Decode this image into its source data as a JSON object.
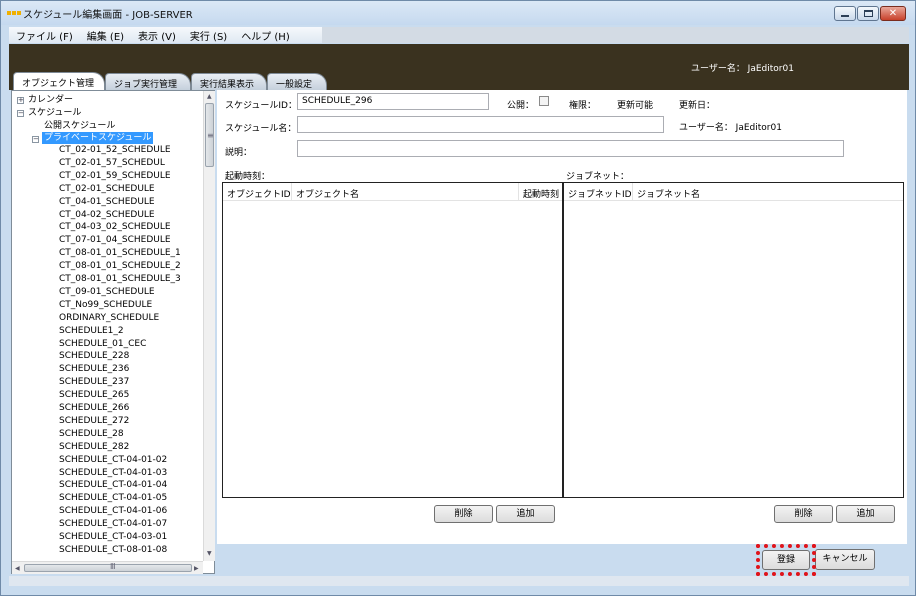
{
  "window": {
    "title": "スケジュール編集画面 - JOB-SERVER"
  },
  "menu": [
    {
      "label": "ファイル (F)"
    },
    {
      "label": "編集 (E)"
    },
    {
      "label": "表示 (V)"
    },
    {
      "label": "実行 (S)"
    },
    {
      "label": "ヘルプ (H)"
    }
  ],
  "header": {
    "user": "ユーザー名： JaEditor01"
  },
  "tabs": [
    {
      "label": "オブジェクト管理",
      "active": true
    },
    {
      "label": "ジョブ実行管理",
      "active": false
    },
    {
      "label": "実行結果表示",
      "active": false
    },
    {
      "label": "一般設定",
      "active": false
    }
  ],
  "tree": {
    "calendar": "カレンダー",
    "schedule": "スケジュール",
    "public_schedule": "公開スケジュール",
    "private_schedule": "プライベートスケジュール",
    "items": [
      "CT_02-01_52_SCHEDULE",
      "CT_02-01_57_SCHEDUL",
      "CT_02-01_59_SCHEDULE",
      "CT_02-01_SCHEDULE",
      "CT_04-01_SCHEDULE",
      "CT_04-02_SCHEDULE",
      "CT_04-03_02_SCHEDULE",
      "CT_07-01_04_SCHEDULE",
      "CT_08-01_01_SCHEDULE_1",
      "CT_08-01_01_SCHEDULE_2",
      "CT_08-01_01_SCHEDULE_3",
      "CT_09-01_SCHEDULE",
      "CT_No99_SCHEDULE",
      "ORDINARY_SCHEDULE",
      "SCHEDULE1_2",
      "SCHEDULE_01_CEC",
      "SCHEDULE_228",
      "SCHEDULE_236",
      "SCHEDULE_237",
      "SCHEDULE_265",
      "SCHEDULE_266",
      "SCHEDULE_272",
      "SCHEDULE_28",
      "SCHEDULE_282",
      "SCHEDULE_CT-04-01-02",
      "SCHEDULE_CT-04-01-03",
      "SCHEDULE_CT-04-01-04",
      "SCHEDULE_CT-04-01-05",
      "SCHEDULE_CT-04-01-06",
      "SCHEDULE_CT-04-01-07",
      "SCHEDULE_CT-04-03-01",
      "SCHEDULE_CT-08-01-08"
    ],
    "hscroll_grip": "Ⅲ"
  },
  "form": {
    "schedule_id_label": "スケジュールID：",
    "schedule_id_value": "SCHEDULE_296",
    "public_label": "公開：",
    "permission_label": "権限：",
    "permission_value": "更新可能",
    "updated_label": "更新日：",
    "schedule_name_label": "スケジュール名：",
    "schedule_name_value": "",
    "user_label": "ユーザー名： JaEditor01",
    "description_label": "説明：",
    "description_value": ""
  },
  "start_time_grid": {
    "title": "起動時刻：",
    "columns": [
      "オブジェクトID",
      "オブジェクト名",
      "起動時刻"
    ],
    "delete_label": "削除",
    "add_label": "追加"
  },
  "jobnet_grid": {
    "title": "ジョブネット：",
    "columns": [
      "ジョブネットID",
      "ジョブネット名"
    ],
    "delete_label": "削除",
    "add_label": "追加"
  },
  "footer": {
    "register_label": "登録",
    "cancel_label": "キャンセル"
  },
  "colors": {
    "header_bg": "#3a321f",
    "selection": "#3399ff",
    "highlight": "#e0141b"
  }
}
